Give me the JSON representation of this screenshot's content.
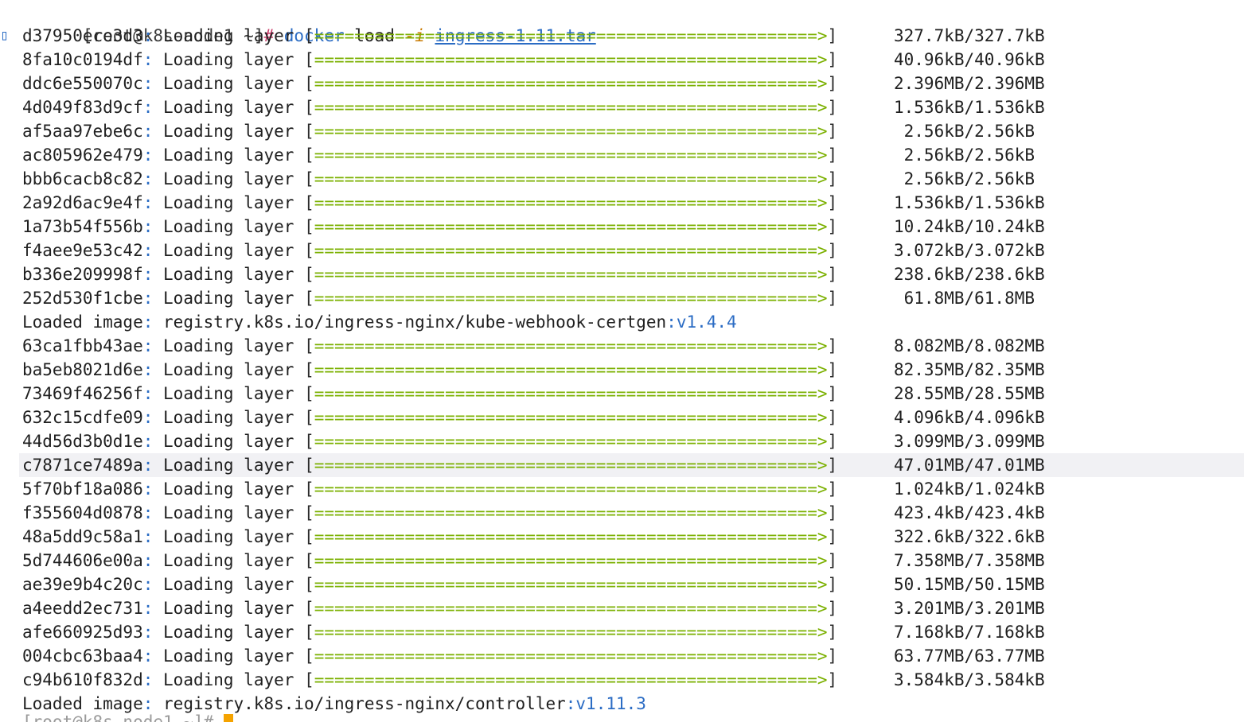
{
  "prompt": {
    "user_host": "[root@k8s-node1 ~]",
    "hash": "#",
    "command": "docker",
    "subcommand": "load",
    "flag": "-i",
    "argument": "ingress-1.11.tar"
  },
  "loading_label": "Loading layer",
  "progress_bar": "==================================================>",
  "block1": [
    {
      "id": "d37950ece3d3",
      "size": "327.7kB/327.7kB"
    },
    {
      "id": "8fa10c0194df",
      "size": "40.96kB/40.96kB"
    },
    {
      "id": "ddc6e550070c",
      "size": "2.396MB/2.396MB"
    },
    {
      "id": "4d049f83d9cf",
      "size": "1.536kB/1.536kB"
    },
    {
      "id": "af5aa97ebe6c",
      "size": " 2.56kB/2.56kB"
    },
    {
      "id": "ac805962e479",
      "size": " 2.56kB/2.56kB"
    },
    {
      "id": "bbb6cacb8c82",
      "size": " 2.56kB/2.56kB"
    },
    {
      "id": "2a92d6ac9e4f",
      "size": "1.536kB/1.536kB"
    },
    {
      "id": "1a73b54f556b",
      "size": "10.24kB/10.24kB"
    },
    {
      "id": "f4aee9e53c42",
      "size": "3.072kB/3.072kB"
    },
    {
      "id": "b336e209998f",
      "size": "238.6kB/238.6kB"
    },
    {
      "id": "252d530f1cbe",
      "size": " 61.8MB/61.8MB"
    }
  ],
  "loaded1": {
    "label": "Loaded image",
    "image": "registry.k8s.io/ingress-nginx/kube-webhook-certgen",
    "tag": ":v1.4.4"
  },
  "block2": [
    {
      "id": "63ca1fbb43ae",
      "size": "8.082MB/8.082MB"
    },
    {
      "id": "ba5eb8021d6e",
      "size": "82.35MB/82.35MB"
    },
    {
      "id": "73469f46256f",
      "size": "28.55MB/28.55MB"
    },
    {
      "id": "632c15cdfe09",
      "size": "4.096kB/4.096kB"
    },
    {
      "id": "44d56d3b0d1e",
      "size": "3.099MB/3.099MB"
    },
    {
      "id": "c7871ce7489a",
      "size": "47.01MB/47.01MB"
    },
    {
      "id": "5f70bf18a086",
      "size": "1.024kB/1.024kB"
    },
    {
      "id": "f355604d0878",
      "size": "423.4kB/423.4kB"
    },
    {
      "id": "48a5dd9c58a1",
      "size": "322.6kB/322.6kB"
    },
    {
      "id": "5d744606e00a",
      "size": "7.358MB/7.358MB"
    },
    {
      "id": "ae39e9b4c20c",
      "size": "50.15MB/50.15MB"
    },
    {
      "id": "a4eedd2ec731",
      "size": "3.201MB/3.201MB"
    },
    {
      "id": "afe660925d93",
      "size": "7.168kB/7.168kB"
    },
    {
      "id": "004cbc63baa4",
      "size": "63.77MB/63.77MB"
    },
    {
      "id": "c94b610f832d",
      "size": "3.584kB/3.584kB"
    }
  ],
  "loaded2": {
    "label": "Loaded image",
    "image": "registry.k8s.io/ingress-nginx/controller",
    "tag": ":v1.11.3"
  },
  "highlighted_row_id": "c7871ce7489a",
  "colors": {
    "prompt_hash": "#c93c6a",
    "command": "#2b6cc4",
    "flag": "#c97a00",
    "progress": "#7bb000",
    "cursor": "#f5a300",
    "highlight": "#f1f1f4"
  }
}
